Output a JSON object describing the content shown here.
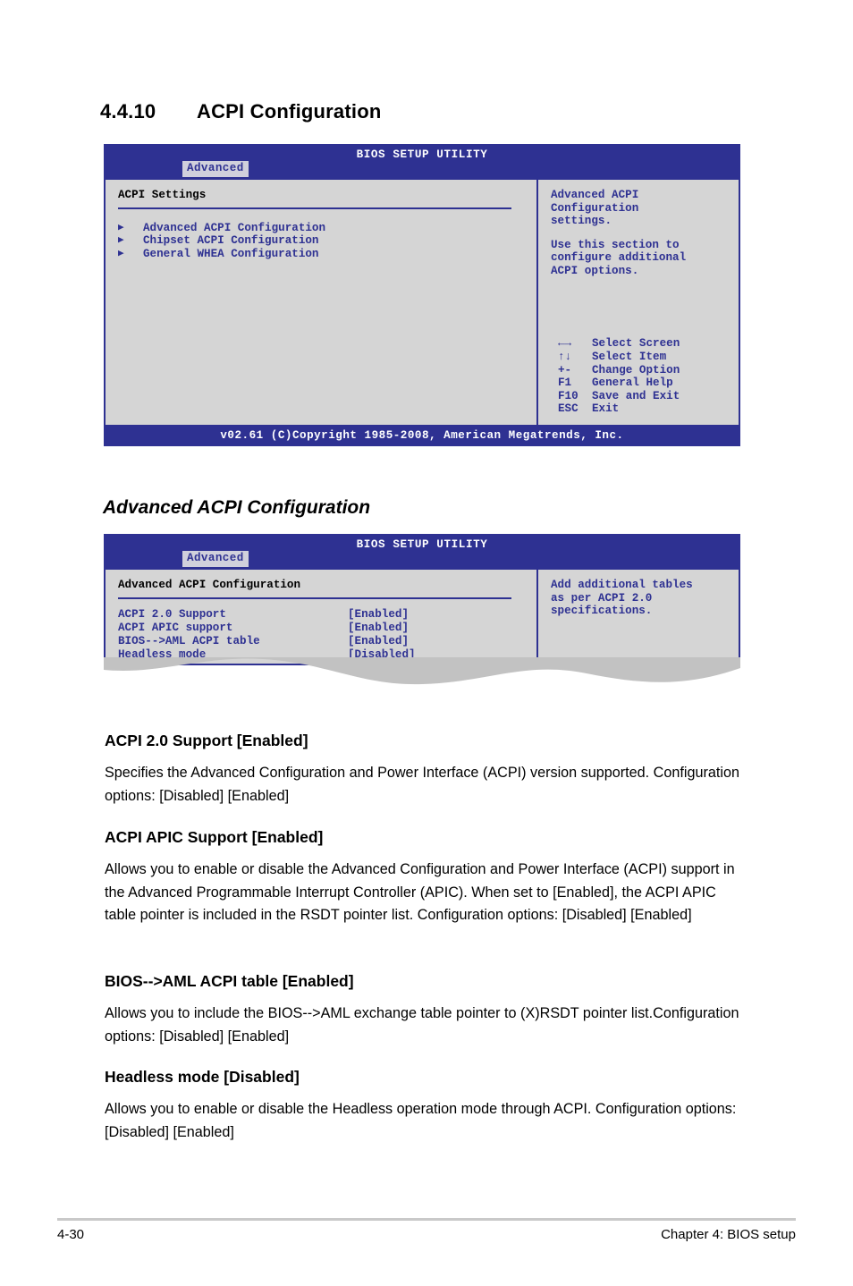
{
  "section": {
    "number": "4.4.10",
    "title": "ACPI Configuration"
  },
  "bios_screen_1": {
    "title": "BIOS SETUP UTILITY",
    "tab": "Advanced",
    "panel_title": "ACPI Settings",
    "menu_items": [
      "Advanced ACPI Configuration",
      "Chipset ACPI Configuration",
      "General WHEA Configuration"
    ],
    "help": [
      [
        "Advanced ACPI",
        "Configuration",
        "settings."
      ],
      [
        "Use this section to",
        "configure additional",
        "ACPI options."
      ]
    ],
    "nav": [
      {
        "key": "←→",
        "desc": "Select Screen"
      },
      {
        "key": "↑↓",
        "desc": "Select Item"
      },
      {
        "key": "+-",
        "desc": "Change Option"
      },
      {
        "key": "F1",
        "desc": "General Help"
      },
      {
        "key": "F10",
        "desc": "Save and Exit"
      },
      {
        "key": "ESC",
        "desc": "Exit"
      }
    ],
    "footer": "v02.61 (C)Copyright 1985-2008, American Megatrends, Inc."
  },
  "subsection": {
    "title": "Advanced ACPI Configuration"
  },
  "bios_screen_2": {
    "title": "BIOS SETUP UTILITY",
    "tab": "Advanced",
    "panel_title": "Advanced ACPI Configuration",
    "settings": [
      {
        "name": "ACPI 2.0 Support",
        "value": "[Enabled]"
      },
      {
        "name": "ACPI APIC support",
        "value": "[Enabled]"
      },
      {
        "name": "BIOS-->AML ACPI table",
        "value": "[Enabled]"
      },
      {
        "name": "Headless mode",
        "value": "[Disabled]"
      }
    ],
    "help": [
      [
        "Add additional tables",
        "as per ACPI 2.0",
        "specifications."
      ]
    ]
  },
  "descriptions": [
    {
      "heading": "ACPI 2.0 Support [Enabled]",
      "body": "Specifies the Advanced Configuration and Power Interface (ACPI) version supported. Configuration options: [Disabled] [Enabled]"
    },
    {
      "heading": "ACPI APIC Support [Enabled]",
      "body": "Allows you to enable or disable the Advanced Configuration and Power Interface (ACPI) support in the Advanced Programmable Interrupt Controller (APIC). When set to [Enabled], the ACPI APIC table pointer is included in the RSDT pointer list. Configuration options: [Disabled] [Enabled]"
    },
    {
      "heading": "BIOS-->AML ACPI table [Enabled]",
      "body": "Allows you to include the BIOS-->AML exchange table pointer to (X)RSDT pointer list.Configuration options: [Disabled] [Enabled]"
    },
    {
      "heading": "Headless mode [Disabled]",
      "body": "Allows you to enable or disable the Headless operation mode through ACPI. Configuration options: [Disabled] [Enabled]"
    }
  ],
  "page_footer": {
    "page_number": "4-30",
    "chapter": "Chapter 4: BIOS setup"
  },
  "colors": {
    "bios_blue": "#2e3192",
    "panel_gray": "#d5d5d5",
    "torn_gray": "#c2c2c2"
  }
}
